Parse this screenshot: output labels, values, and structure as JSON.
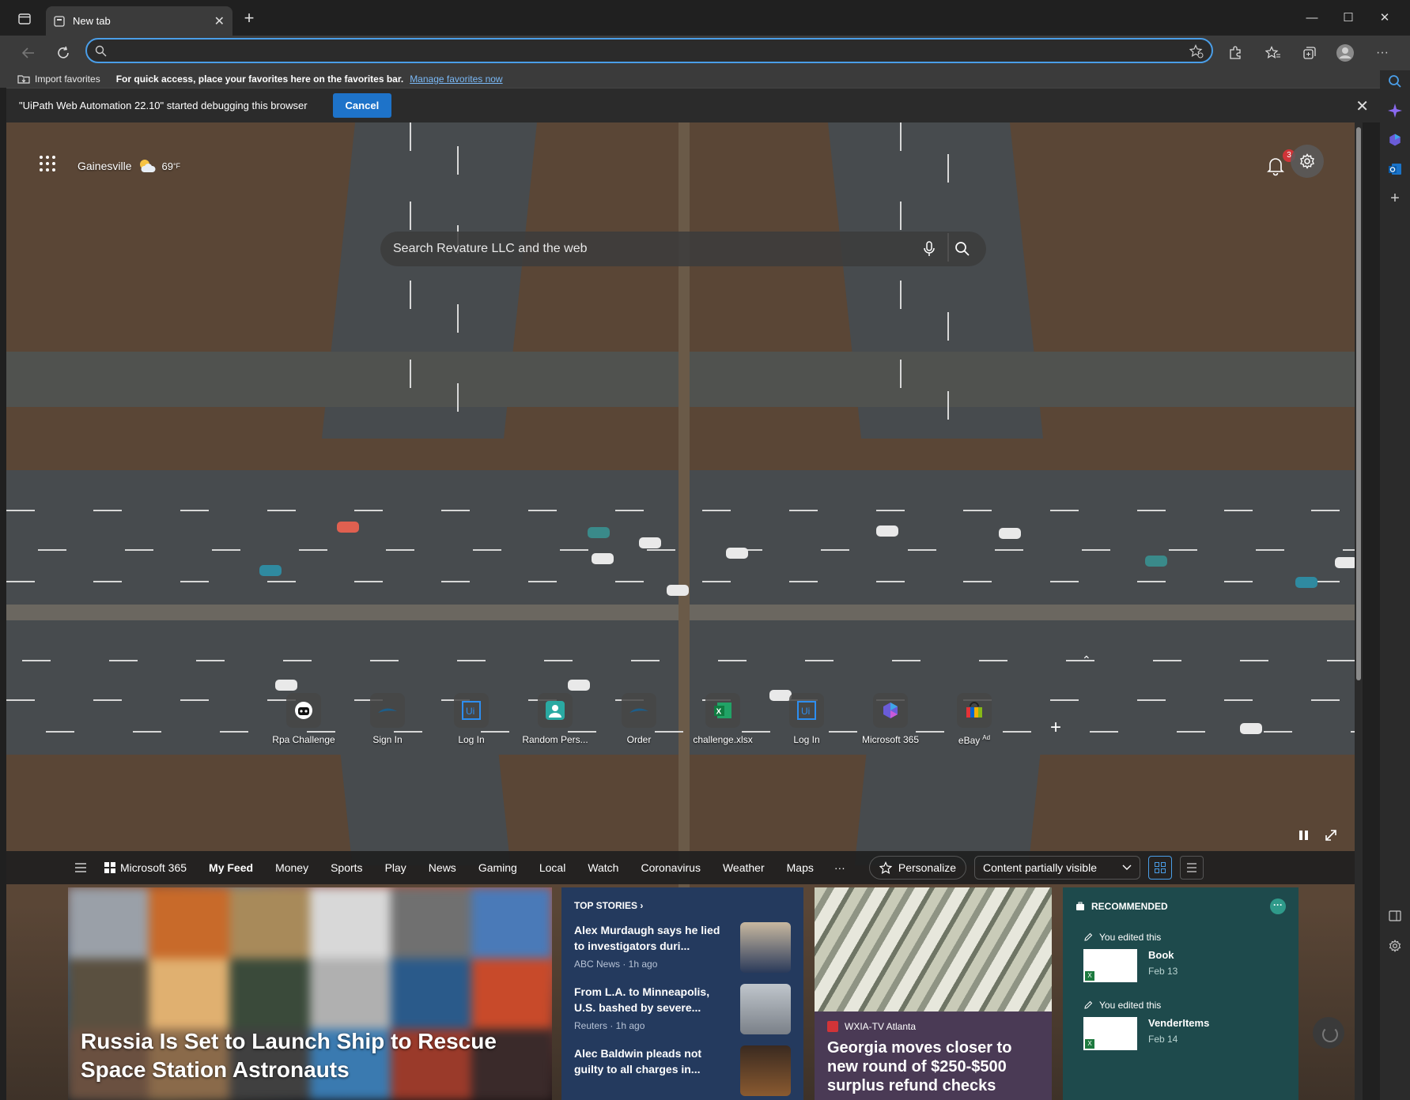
{
  "browser": {
    "tab_title": "New tab",
    "address_value": "",
    "window_controls": [
      "minimize",
      "maximize",
      "close"
    ]
  },
  "favorites_bar": {
    "import_label": "Import favorites",
    "hint": "For quick access, place your favorites here on the favorites bar.",
    "manage_link": "Manage favorites now"
  },
  "infobar": {
    "message": "\"UiPath Web Automation 22.10\" started debugging this browser",
    "cancel_label": "Cancel"
  },
  "newtab": {
    "location": "Gainesville",
    "temperature": "69",
    "temp_unit": "°F",
    "notification_count": "3",
    "search_placeholder": "Search Revature LLC and the web",
    "quick_links": [
      {
        "label": "Rpa Challenge",
        "icon": "robot-icon"
      },
      {
        "label": "Sign In",
        "icon": "whale-icon"
      },
      {
        "label": "Log In",
        "icon": "uipath-icon"
      },
      {
        "label": "Random Pers...",
        "icon": "person-icon"
      },
      {
        "label": "Order",
        "icon": "whale-icon"
      },
      {
        "label": "challenge.xlsx",
        "icon": "excel-icon"
      },
      {
        "label": "Log In",
        "icon": "uipath-icon"
      },
      {
        "label": "Microsoft 365",
        "icon": "m365-icon"
      },
      {
        "label": "eBay",
        "icon": "ebay-icon",
        "ad": "Ad"
      }
    ]
  },
  "feed_nav": {
    "items": [
      "Microsoft 365",
      "My Feed",
      "Money",
      "Sports",
      "Play",
      "News",
      "Gaming",
      "Local",
      "Watch",
      "Coronavirus",
      "Weather",
      "Maps"
    ],
    "more": "···",
    "personalize": "Personalize",
    "content_visibility": "Content partially visible"
  },
  "cards": {
    "hero_title": "Russia Is Set to Launch Ship to Rescue Space Station Astronauts",
    "top_stories_header": "TOP STORIES ›",
    "stories": [
      {
        "title": "Alex Murdaugh says he lied to investigators duri...",
        "source": "ABC News · 1h ago"
      },
      {
        "title": "From L.A. to Minneapolis, U.S. bashed by severe...",
        "source": "Reuters · 1h ago"
      },
      {
        "title": "Alec Baldwin pleads not guilty to all charges in...",
        "source": ""
      }
    ],
    "money_source": "WXIA-TV Atlanta",
    "money_title": "Georgia moves closer to new round of $250-$500 surplus refund checks",
    "recommended_header": "RECOMMENDED",
    "recommended": [
      {
        "edited": "You edited this",
        "name": "Book",
        "date": "Feb 13"
      },
      {
        "edited": "You edited this",
        "name": "VenderItems",
        "date": "Feb 14"
      }
    ]
  },
  "colors": {
    "accent": "#4a9ee8",
    "cancel_button": "#1e73c9",
    "top_stories_bg": "#243a5e",
    "recommended_bg": "#1e4a4c",
    "badge": "#d13438"
  }
}
